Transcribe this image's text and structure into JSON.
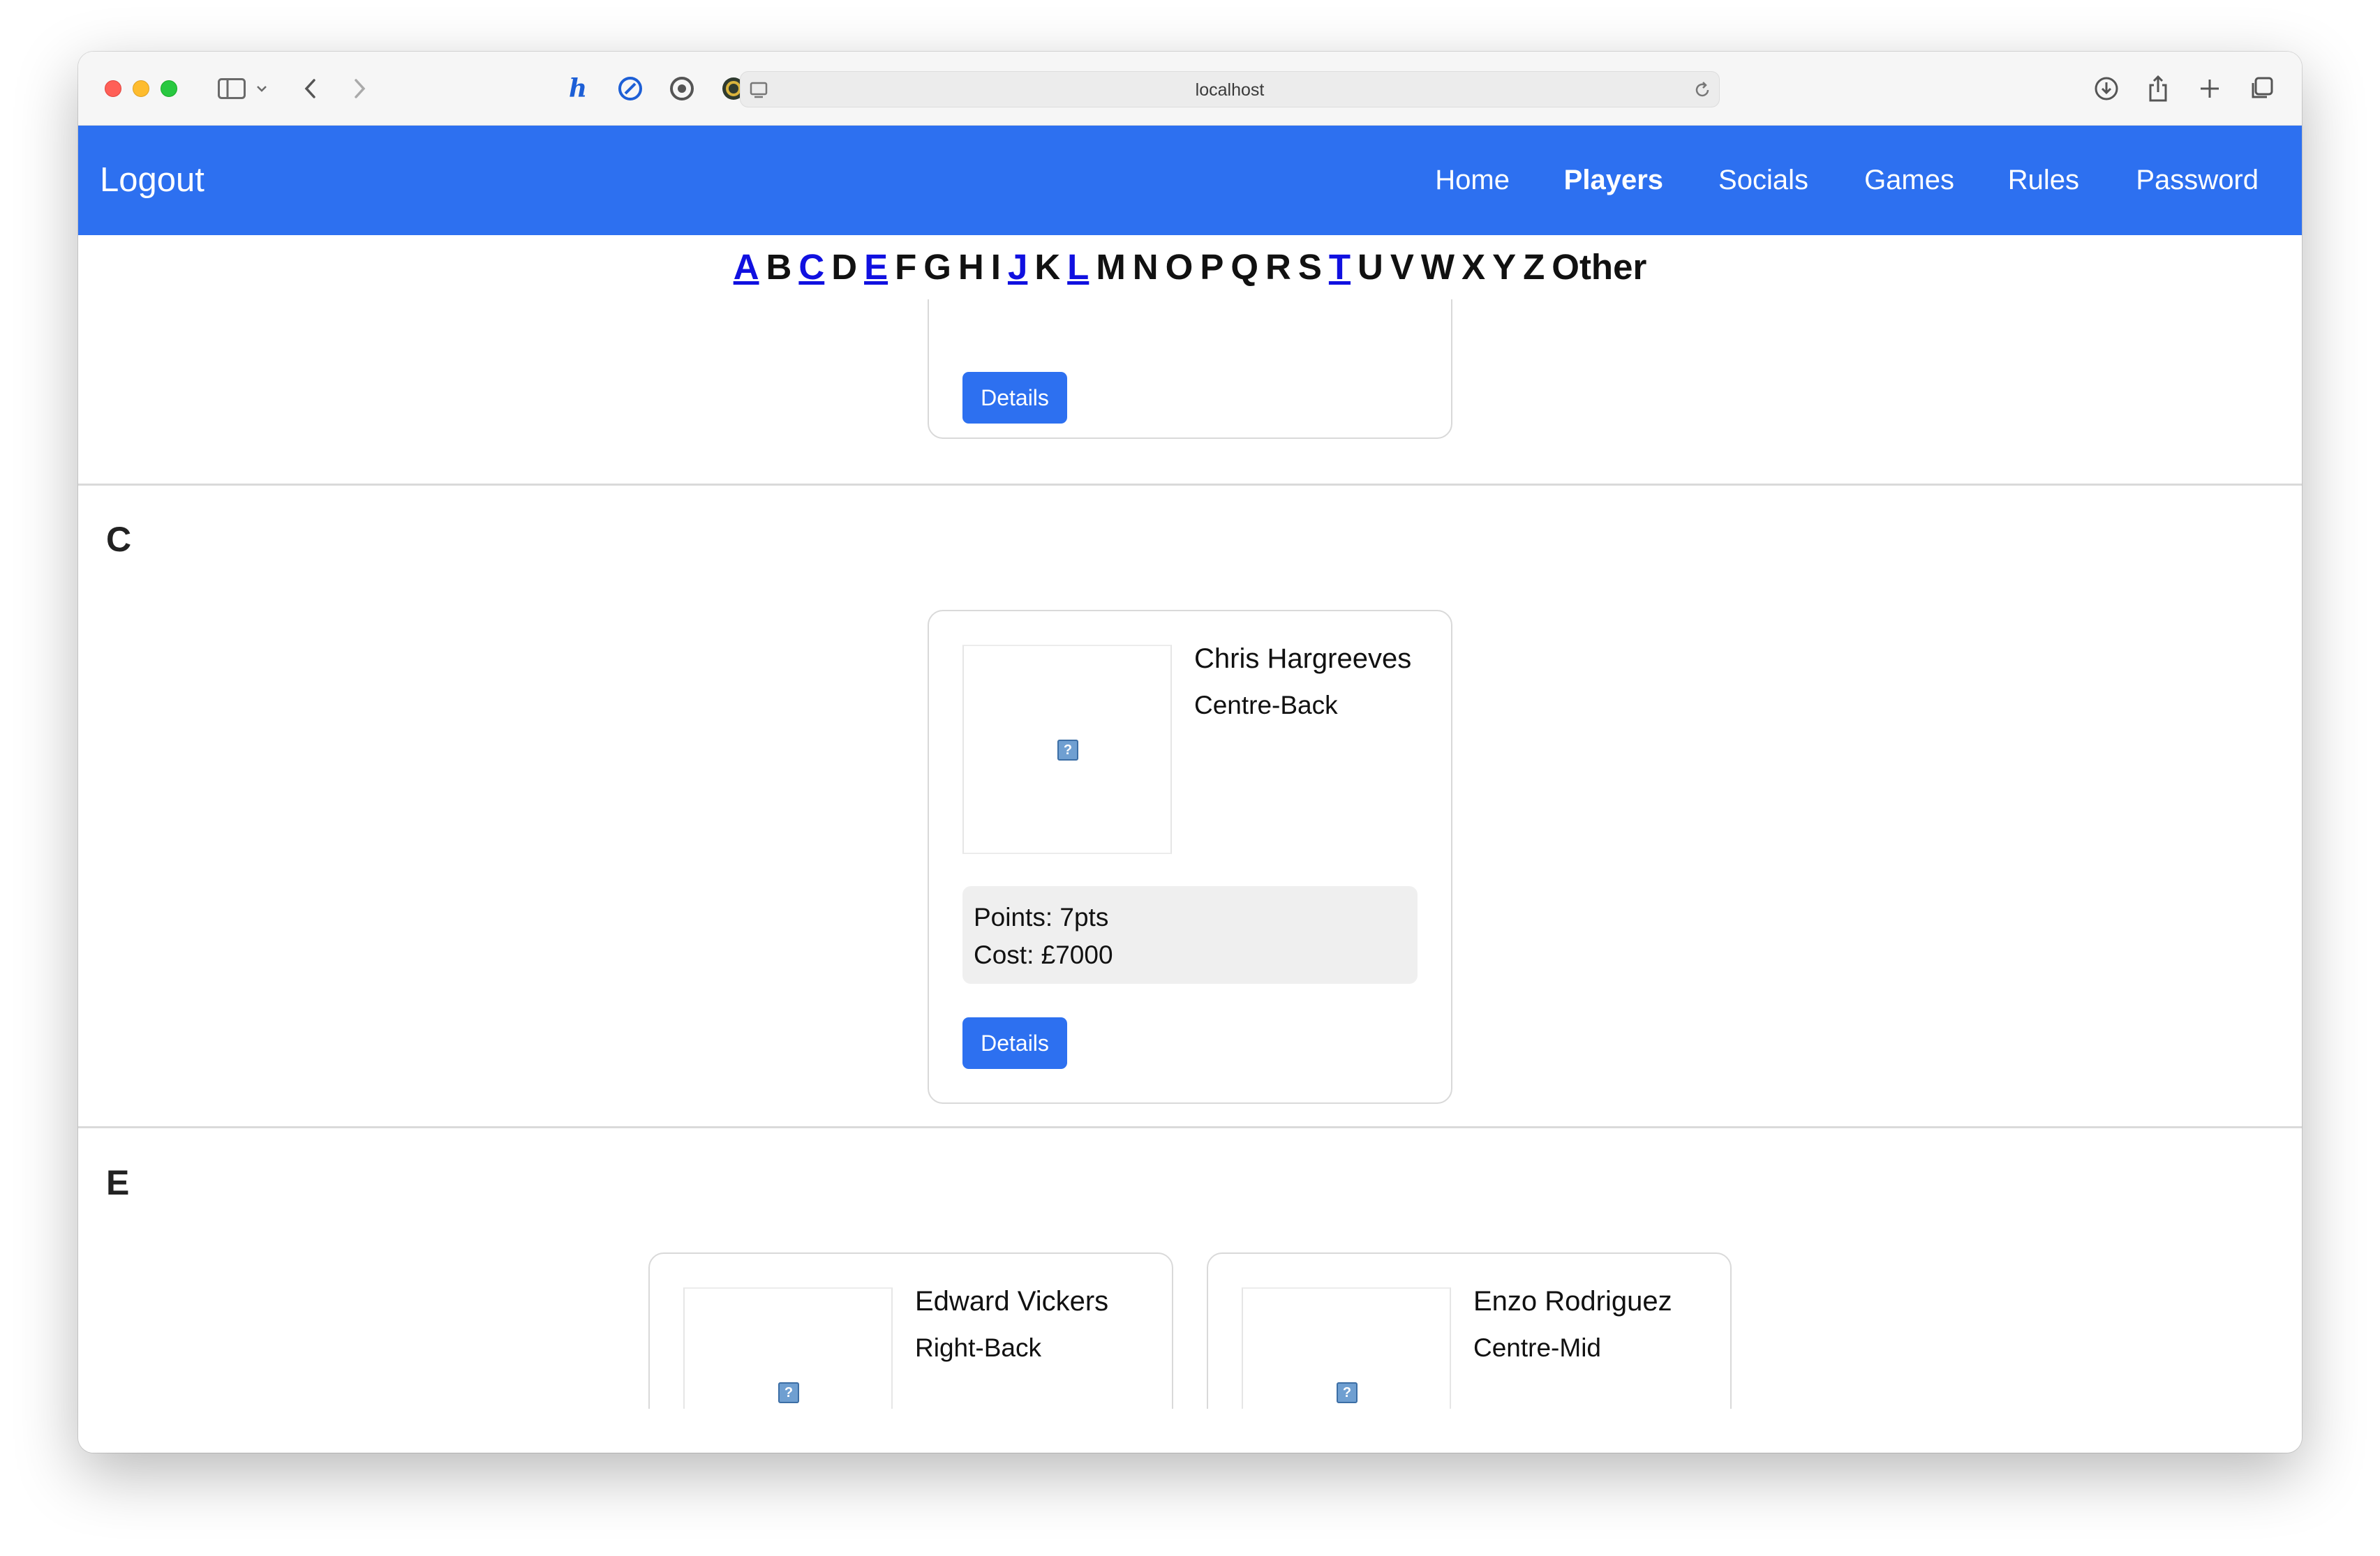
{
  "browser": {
    "url": "localhost"
  },
  "navbar": {
    "brand": "Logout",
    "links": [
      {
        "label": "Home",
        "active": false
      },
      {
        "label": "Players",
        "active": true
      },
      {
        "label": "Socials",
        "active": false
      },
      {
        "label": "Games",
        "active": false
      },
      {
        "label": "Rules",
        "active": false
      },
      {
        "label": "Password",
        "active": false
      }
    ]
  },
  "alphabet": [
    {
      "letter": "A",
      "link": true
    },
    {
      "letter": "B",
      "link": false
    },
    {
      "letter": "C",
      "link": true
    },
    {
      "letter": "D",
      "link": false
    },
    {
      "letter": "E",
      "link": true
    },
    {
      "letter": "F",
      "link": false
    },
    {
      "letter": "G",
      "link": false
    },
    {
      "letter": "H",
      "link": false
    },
    {
      "letter": "I",
      "link": false
    },
    {
      "letter": "J",
      "link": true
    },
    {
      "letter": "K",
      "link": false
    },
    {
      "letter": "L",
      "link": true
    },
    {
      "letter": "M",
      "link": false
    },
    {
      "letter": "N",
      "link": false
    },
    {
      "letter": "O",
      "link": false
    },
    {
      "letter": "P",
      "link": false
    },
    {
      "letter": "Q",
      "link": false
    },
    {
      "letter": "R",
      "link": false
    },
    {
      "letter": "S",
      "link": false
    },
    {
      "letter": "T",
      "link": true
    },
    {
      "letter": "U",
      "link": false
    },
    {
      "letter": "V",
      "link": false
    },
    {
      "letter": "W",
      "link": false
    },
    {
      "letter": "X",
      "link": false
    },
    {
      "letter": "Y",
      "link": false
    },
    {
      "letter": "Z",
      "link": false
    },
    {
      "letter": "Other",
      "link": false
    }
  ],
  "sections": {
    "prev_card": {
      "details_label": "Details"
    },
    "c": {
      "letter": "C",
      "players": [
        {
          "name": "Chris Hargreeves",
          "position": "Centre-Back",
          "points": "Points: 7pts",
          "cost": "Cost: £7000",
          "details_label": "Details",
          "photo_alt": "?"
        }
      ]
    },
    "e": {
      "letter": "E",
      "players": [
        {
          "name": "Edward Vickers",
          "position": "Right-Back",
          "photo_alt": "?"
        },
        {
          "name": "Enzo Rodriguez",
          "position": "Centre-Mid",
          "photo_alt": "?"
        }
      ]
    }
  },
  "colors": {
    "navbar": "#2d70f0",
    "button": "#2d70f0",
    "alpha_link": "#1010e0"
  }
}
